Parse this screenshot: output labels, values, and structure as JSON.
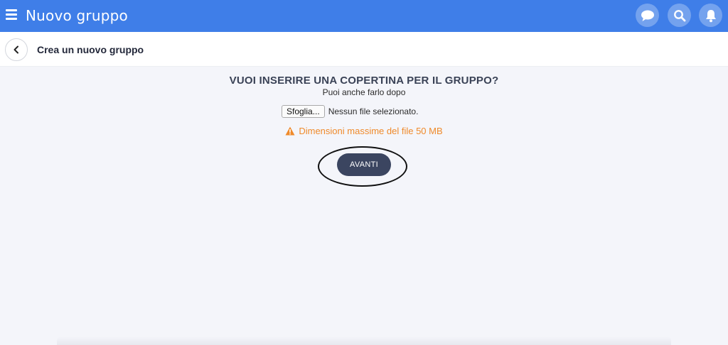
{
  "header": {
    "title": "Nuovo gruppo",
    "menu_icon": "hamburger-menu-icon",
    "actions": [
      "chat-icon",
      "search-icon",
      "bell-icon"
    ]
  },
  "subheader": {
    "back_icon": "chevron-left-icon",
    "title": "Crea un nuovo gruppo"
  },
  "cover": {
    "question": "VUOI INSERIRE UNA COPERTINA PER IL GRUPPO?",
    "hint": "Puoi anche farlo dopo",
    "browse_label": "Sfoglia...",
    "file_status": "Nessun file selezionato.",
    "warning_icon": "warning-icon",
    "warning_text": "Dimensioni massime del file 50 MB",
    "next_label": "AVANTI"
  },
  "colors": {
    "topbar": "#3f7ee8",
    "warning": "#ef8a2b",
    "primary_button": "#3b4560"
  }
}
